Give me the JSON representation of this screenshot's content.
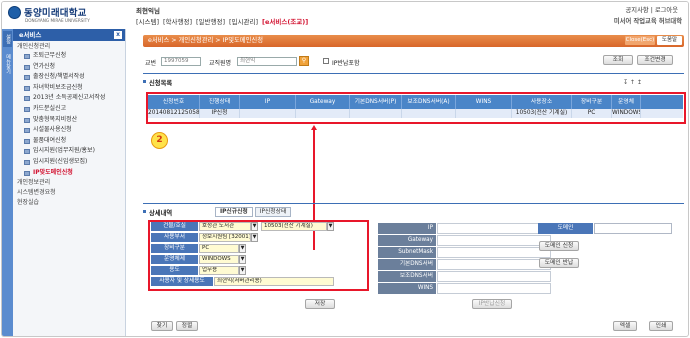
{
  "header": {
    "logo_name": "동양미래대학교",
    "logo_sub": "DONGYANG MIRAE UNIVERSITY",
    "user": "최현익님",
    "nav": [
      "[시스템]",
      "[학사행정]",
      "[일반행정]",
      "[입시관리]",
      "[e서비스(조교)]"
    ],
    "links": "공지사항 | 로그아웃",
    "subtitle": "미서어 작업교육 허브대학"
  },
  "vtabs": [
    "설정",
    "메뉴찾기"
  ],
  "sidebar": {
    "title": "e서비스",
    "close": "x",
    "group": "개인신청관리",
    "items": [
      "조퇴근무신청",
      "연가신청",
      "출장신청/책별서작성",
      "자녀학비보조금신청",
      "2013년 소득공제신고서작성",
      "카드분실신고",
      "맞춤형복지비정산",
      "시설물사용신청",
      "물품대여신청",
      "입시지원(업무지원/홍보)",
      "입시지원(신입생모집)",
      "IP맞도메인신청"
    ],
    "foot": [
      "개인정보관리",
      "시스템변경요청",
      "현장실습"
    ]
  },
  "crumb": {
    "text": "e서비스 > 개인신청관리 > IP및도메인신청",
    "closebtn": "Close(Esc)",
    "help": "도움말"
  },
  "search": {
    "label_id": "교번",
    "id_value": "1997059",
    "label_name": "교직원명",
    "name_value": "최현익",
    "check_label": "IP반납포함",
    "query_btn": "조회",
    "reset_btn": "조건변경"
  },
  "list": {
    "title": "신청목록",
    "columns": [
      "신청번호",
      "진행상태",
      "IP",
      "Gateway",
      "기본DNS서버(P)",
      "보조DNS서버(A)",
      "WINS",
      "사용장소",
      "장비구분",
      "운영체"
    ],
    "rows": [
      [
        "20140812125058",
        "IP신청",
        "",
        "",
        "",
        "",
        "",
        "10503(전산 기계실)",
        "PC",
        "WINDOWS"
      ]
    ],
    "marker": "2"
  },
  "detail": {
    "title": "상세내역",
    "tabs": [
      "IP신규신청",
      "IP신청상태"
    ],
    "fields": [
      {
        "label": "건물/호실",
        "v1": "호성관 도서관",
        "v2": "10503(전산 기계실)"
      },
      {
        "label": "사용부서",
        "v1": "정보지원팀 [32001]"
      },
      {
        "label": "장비구분",
        "v1": "PC"
      },
      {
        "label": "운영체제",
        "v1": "WINDOWS"
      },
      {
        "label": "용도",
        "v1": "업무용"
      },
      {
        "label": "사용자 및 상세용도",
        "v1": "최현익(서버관리용)"
      }
    ],
    "net_labels": [
      "IP",
      "Gateway",
      "SubnetMask",
      "기본DNS서버",
      "보조DNS서버",
      "WINS"
    ],
    "domain_label": "도메인",
    "domain_btns": [
      "도메인 신청",
      "도메인 반납"
    ],
    "save": "저장",
    "ip_return": "IP반납신청"
  },
  "bottom": {
    "find": "찾기",
    "sort": "정렬",
    "excel": "엑셀",
    "print": "인쇄"
  }
}
